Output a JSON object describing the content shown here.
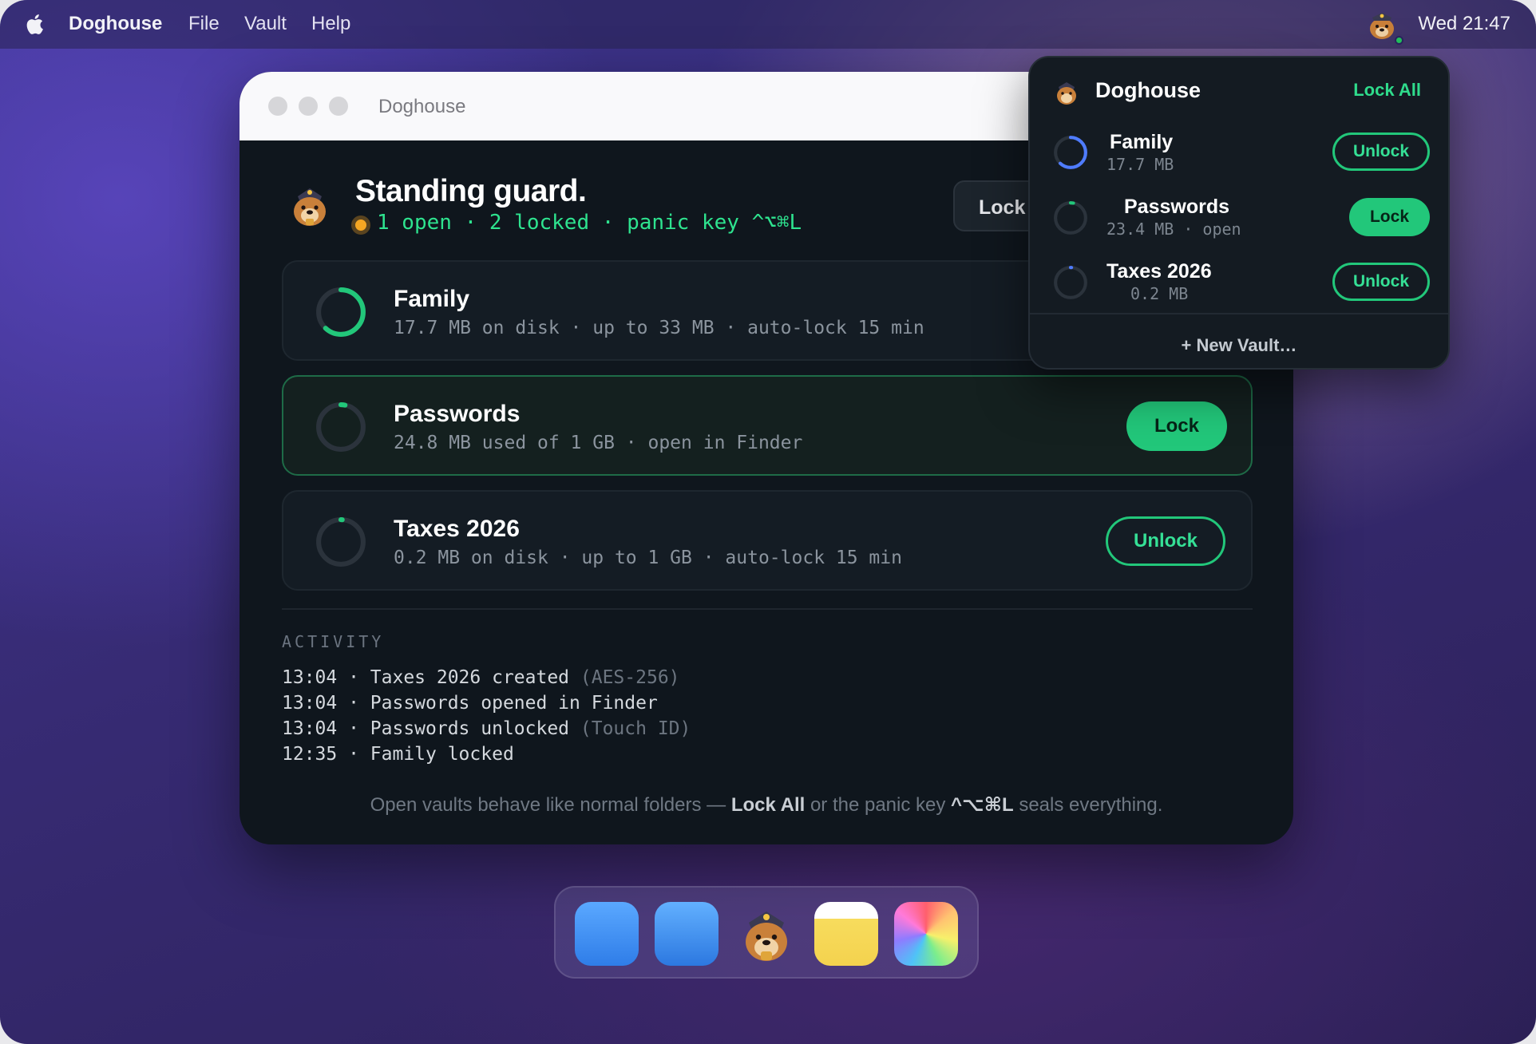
{
  "menubar": {
    "app_name": "Doghouse",
    "items": [
      "File",
      "Vault",
      "Help"
    ],
    "clock": "Wed 21:47",
    "tray_icon": "bulldog-icon",
    "tray_status_color": "#23c55e"
  },
  "window": {
    "title": "Doghouse",
    "hero_title": "Standing guard.",
    "status_line": "1 open · 2 locked · panic key ^⌥⌘L",
    "status_dot_color": "#f5a623",
    "lock_all_label": "Lock"
  },
  "vaults": [
    {
      "name": "Family",
      "meta": "17.7 MB on disk · up to 33 MB · auto-lock 15 min",
      "state": "locked",
      "ring_progress": 0.62,
      "ring_color": "#22c77a"
    },
    {
      "name": "Passwords",
      "meta": "24.8 MB used of 1 GB · open in Finder",
      "state": "open",
      "action_label": "Lock",
      "ring_progress": 0.03,
      "ring_color": "#22c77a"
    },
    {
      "name": "Taxes 2026",
      "meta": "0.2 MB on disk · up to 1 GB · auto-lock 15 min",
      "state": "locked",
      "action_label": "Unlock",
      "ring_progress": 0.01,
      "ring_color": "#22c77a"
    }
  ],
  "activity": {
    "heading": "ACTIVITY",
    "entries": [
      {
        "text": "13:04 · Taxes 2026 created",
        "note": "(AES-256)"
      },
      {
        "text": "13:04 · Passwords opened in Finder",
        "note": ""
      },
      {
        "text": "13:04 · Passwords unlocked",
        "note": "(Touch ID)"
      },
      {
        "text": "12:35 · Family locked",
        "note": ""
      }
    ]
  },
  "footer": {
    "part1": "Open vaults behave like normal folders — ",
    "bold1": "Lock All",
    "part2": " or the panic key ",
    "bold2": "^⌥⌘L",
    "part3": " seals everything."
  },
  "popover": {
    "title": "Doghouse",
    "lock_all": "Lock All",
    "items": [
      {
        "name": "Family",
        "meta": "17.7 MB",
        "action": "Unlock",
        "ring_progress": 0.62,
        "ring_color": "#4f7cff"
      },
      {
        "name": "Passwords",
        "meta": "23.4 MB · open",
        "action": "Lock",
        "ring_progress": 0.03,
        "ring_color": "#22c77a"
      },
      {
        "name": "Taxes 2026",
        "meta": "0.2 MB",
        "action": "Unlock",
        "ring_progress": 0.01,
        "ring_color": "#4f7cff"
      }
    ],
    "new_vault": "+ New Vault…"
  },
  "dock": {
    "apps": [
      "finder-app-icon",
      "safari-app-icon",
      "doghouse-app-icon",
      "notes-app-icon",
      "photos-app-icon"
    ]
  }
}
